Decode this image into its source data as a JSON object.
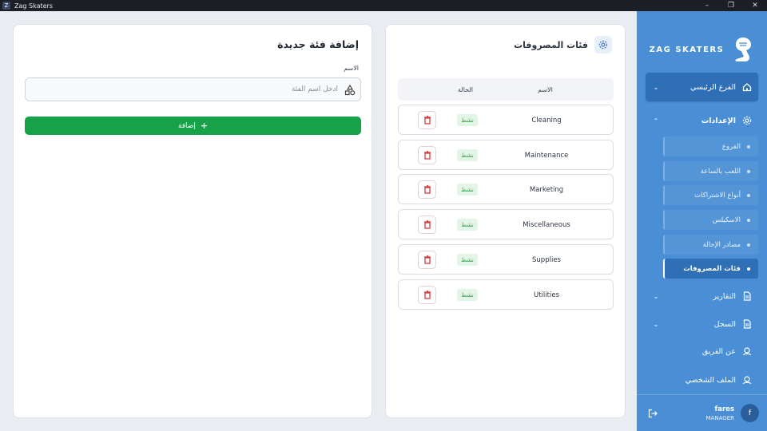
{
  "window": {
    "title": "Zag Skaters",
    "app_icon_letter": "Z"
  },
  "sidebar": {
    "logo_text": "ZAG SKATERS",
    "branch": {
      "label": "الفرع الرئيسي"
    },
    "settings": {
      "label": "الإعدادات",
      "items": [
        {
          "label": "الفروع",
          "active": false
        },
        {
          "label": "اللعب بالساعة",
          "active": false
        },
        {
          "label": "أنواع الاشتراكات",
          "active": false
        },
        {
          "label": "الاسكيلس",
          "active": false
        },
        {
          "label": "مصادر الإحالة",
          "active": false
        },
        {
          "label": "فئات المصروفات",
          "active": true
        }
      ]
    },
    "reports": {
      "label": "التقارير"
    },
    "log": {
      "label": "السجل"
    },
    "about": {
      "label": "عن الفريق"
    },
    "profile": {
      "label": "الملف الشخصي"
    },
    "user": {
      "name": "fares",
      "role": "MANAGER",
      "initial": "f"
    },
    "colors": {
      "background": "#4a8fd6",
      "active": "#2f6fb5"
    }
  },
  "categories_panel": {
    "title": "فئات المصروفات",
    "columns": {
      "name": "الاسم",
      "status": "الحالة"
    },
    "rows": [
      {
        "name": "Cleaning",
        "status": "نشط"
      },
      {
        "name": "Maintenance",
        "status": "نشط"
      },
      {
        "name": "Marketing",
        "status": "نشط"
      },
      {
        "name": "Miscellaneous",
        "status": "نشط"
      },
      {
        "name": "Supplies",
        "status": "نشط"
      },
      {
        "name": "Utilities",
        "status": "نشط"
      }
    ]
  },
  "add_panel": {
    "title": "إضافة فئة جديدة",
    "field_label": "الاسم",
    "placeholder": "أدخل اسم الفئة",
    "value": "",
    "button_label": "إضافة",
    "button_color": "#17a24a"
  }
}
